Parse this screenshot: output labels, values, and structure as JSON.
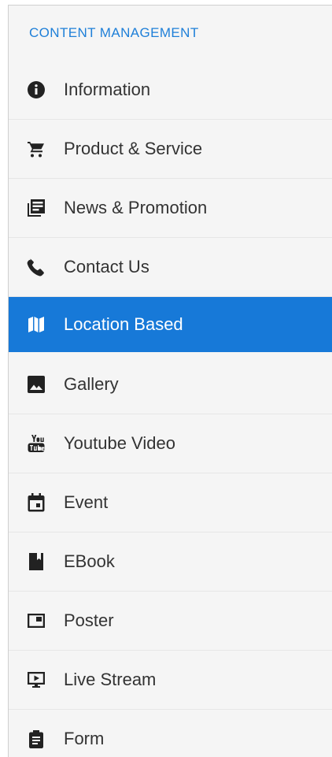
{
  "sidebar": {
    "section_title": "CONTENT MANAGEMENT",
    "accent_color": "#1779d8",
    "active_item": "Location Based",
    "items": [
      {
        "label": "Information",
        "icon": "info-icon"
      },
      {
        "label": "Product & Service",
        "icon": "cart-icon"
      },
      {
        "label": "News & Promotion",
        "icon": "news-icon"
      },
      {
        "label": "Contact Us",
        "icon": "phone-icon"
      },
      {
        "label": "Location Based",
        "icon": "map-icon"
      },
      {
        "label": "Gallery",
        "icon": "image-icon"
      },
      {
        "label": "Youtube Video",
        "icon": "youtube-icon"
      },
      {
        "label": "Event",
        "icon": "calendar-icon"
      },
      {
        "label": "EBook",
        "icon": "book-icon"
      },
      {
        "label": "Poster",
        "icon": "poster-icon"
      },
      {
        "label": "Live Stream",
        "icon": "live-stream-icon"
      },
      {
        "label": "Form",
        "icon": "clipboard-icon"
      }
    ]
  }
}
